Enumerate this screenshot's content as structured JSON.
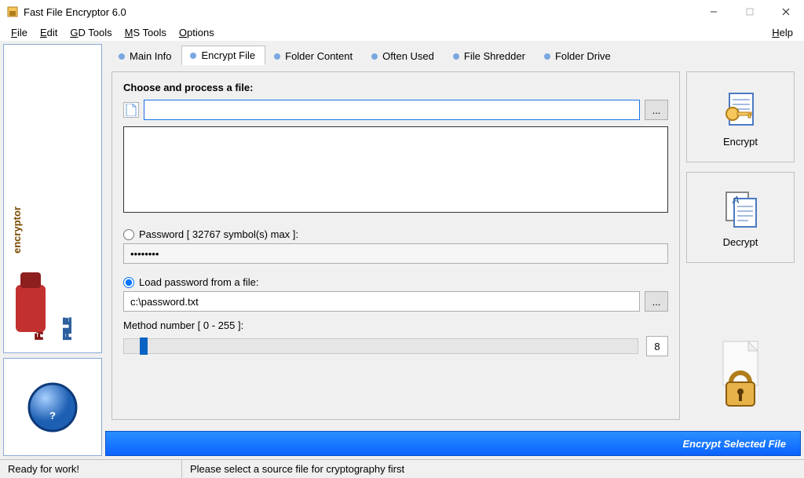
{
  "window": {
    "title": "Fast File Encryptor 6.0"
  },
  "menubar": {
    "file": "File",
    "edit": "Edit",
    "gd_tools": "GD Tools",
    "ms_tools": "MS Tools",
    "options": "Options",
    "help": "Help"
  },
  "tabs": {
    "main_info": "Main Info",
    "encrypt_file": "Encrypt File",
    "folder_content": "Folder Content",
    "often_used": "Often Used",
    "file_shredder": "File Shredder",
    "folder_drive": "Folder Drive"
  },
  "form": {
    "legend": "Choose and process a file:",
    "file_path": "",
    "browse": "...",
    "password_radio_label": "Password [ 32767 symbol(s) max ]:",
    "password_value": "••••••••",
    "load_pwd_radio_label": "Load password from a file:",
    "load_pwd_path": "c:\\password.txt",
    "method_label": "Method number [ 0 - 255 ]:",
    "method_value": "8"
  },
  "actions": {
    "encrypt": "Encrypt",
    "decrypt": "Decrypt"
  },
  "bluebar": {
    "label": "Encrypt Selected File"
  },
  "status": {
    "left": "Ready for work!",
    "right": "Please select a source file for cryptography first"
  }
}
